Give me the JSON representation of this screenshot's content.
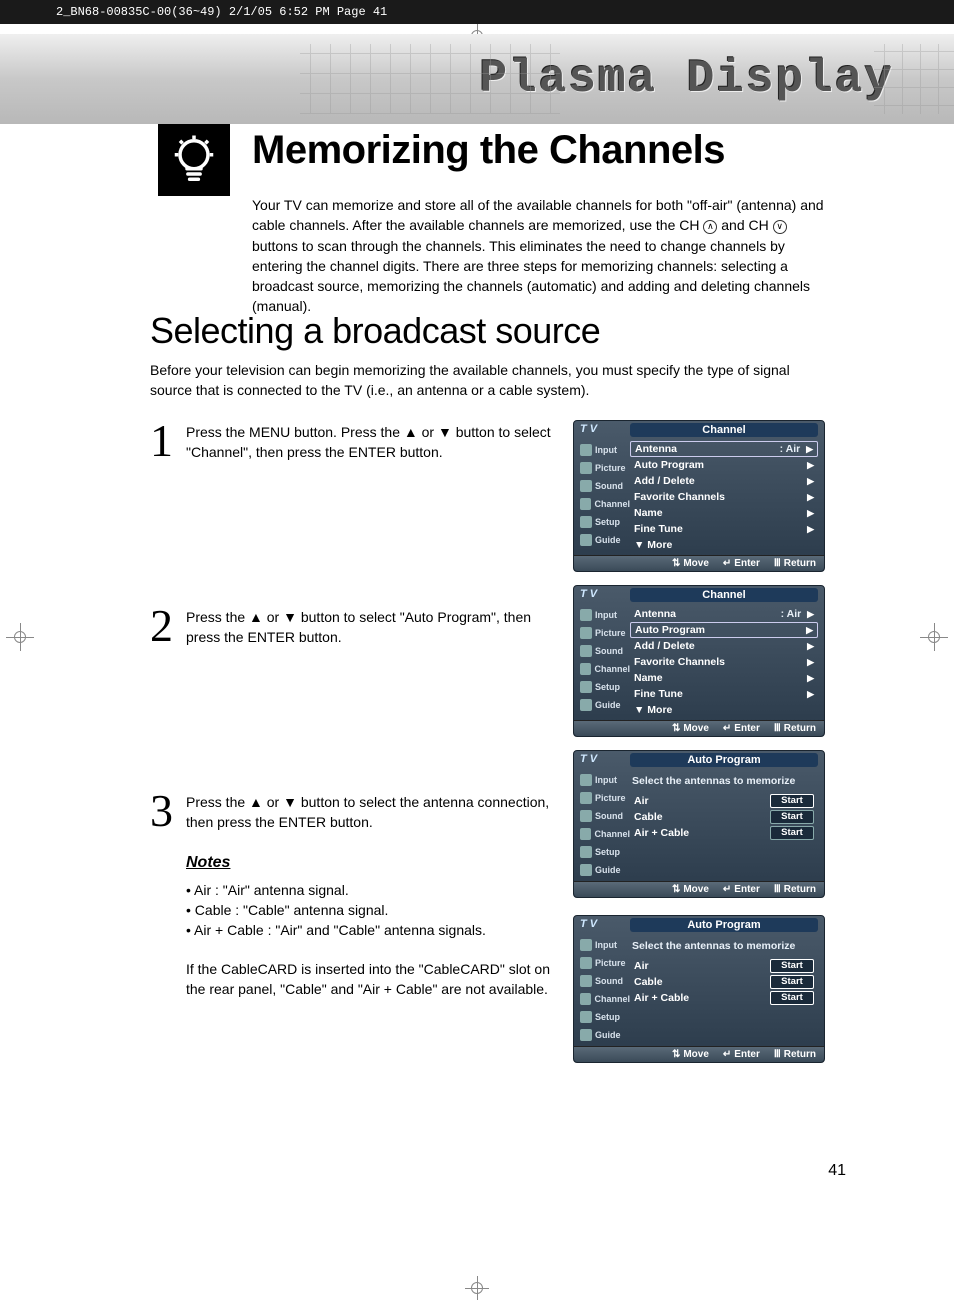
{
  "header_strip": "2_BN68-00835C-00(36~49)  2/1/05  6:52 PM  Page 41",
  "plasma": "Plasma Display",
  "main_title": "Memorizing the Channels",
  "intro_a": "Your TV can memorize and store all of the available channels for both \"off-air\" (antenna) and cable channels. After the available channels are memorized, use the CH ",
  "intro_b": " and CH ",
  "intro_c": " buttons to scan through the channels. This eliminates the need to change channels by entering the channel digits. There are three steps for memorizing channels: selecting a broadcast source, memorizing the channels (automatic) and adding and deleting channels (manual).",
  "section_title": "Selecting a broadcast source",
  "section_intro": "Before your television can begin memorizing the available channels, you must specify the type of signal source that is connected to the TV (i.e., an antenna or a cable system).",
  "steps": [
    {
      "num": "1",
      "text": "Press the MENU button. Press the ▲ or ▼ button to select \"Channel\", then press the ENTER button."
    },
    {
      "num": "2",
      "text": "Press the ▲ or ▼ button to select \"Auto Program\", then press the ENTER button."
    },
    {
      "num": "3",
      "text": "Press the ▲ or ▼ button to select the antenna connection, then press the ENTER button."
    }
  ],
  "notes_h": "Notes",
  "notes": [
    "Air : \"Air\" antenna signal.",
    "Cable : \"Cable\" antenna signal.",
    "Air + Cable : \"Air\" and \"Cable\" antenna signals."
  ],
  "notes_after": "If the CableCARD is inserted into the \"CableCARD\" slot on the rear panel, \"Cable\" and \"Air + Cable\" are not available.",
  "osd": {
    "tv": "T V",
    "sidebar": [
      "Input",
      "Picture",
      "Sound",
      "Channel",
      "Setup",
      "Guide"
    ],
    "channel_title": "Channel",
    "items": [
      {
        "label": "Antenna",
        "val": ": Air"
      },
      {
        "label": "Auto Program",
        "val": ""
      },
      {
        "label": "Add / Delete",
        "val": ""
      },
      {
        "label": "Favorite Channels",
        "val": ""
      },
      {
        "label": "Name",
        "val": ""
      },
      {
        "label": "Fine Tune",
        "val": ""
      },
      {
        "label": "▼ More",
        "val": "",
        "noarrow": true
      }
    ],
    "auto_title": "Auto Program",
    "auto_sub": "Select the antennas to memorize",
    "auto_rows": [
      {
        "label": "Air",
        "btn": "Start"
      },
      {
        "label": "Cable",
        "btn": "Start"
      },
      {
        "label": "Air + Cable",
        "btn": "Start"
      }
    ],
    "foot": {
      "move": "Move",
      "enter": "Enter",
      "return": "Return"
    }
  },
  "page_num": "41"
}
